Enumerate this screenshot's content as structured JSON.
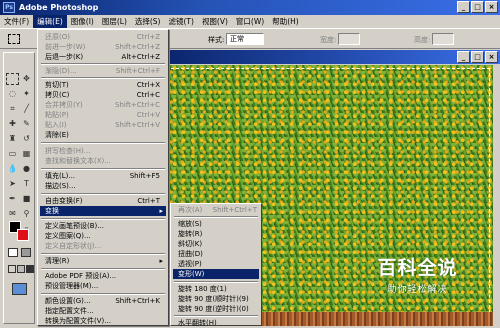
{
  "app": {
    "title": "Adobe Photoshop",
    "icon": "Ps"
  },
  "window_buttons": [
    "_",
    "□",
    "×"
  ],
  "menubar": [
    {
      "label": "文件(F)"
    },
    {
      "label": "编辑(E)"
    },
    {
      "label": "图像(I)"
    },
    {
      "label": "图层(L)"
    },
    {
      "label": "选择(S)"
    },
    {
      "label": "滤镜(T)"
    },
    {
      "label": "视图(V)"
    },
    {
      "label": "窗口(W)"
    },
    {
      "label": "帮助(H)"
    }
  ],
  "options": {
    "style_label": "样式:",
    "style_value": "正常",
    "width_label": "宽度:",
    "height_label": "高度:"
  },
  "edit_menu": [
    {
      "label": "还原(O)",
      "shortcut": "Ctrl+Z",
      "disabled": true
    },
    {
      "label": "前进一步(W)",
      "shortcut": "Shift+Ctrl+Z",
      "disabled": true
    },
    {
      "label": "后退一步(K)",
      "shortcut": "Alt+Ctrl+Z",
      "disabled": false
    },
    {
      "sep": true
    },
    {
      "label": "渐隐(D)...",
      "shortcut": "Shift+Ctrl+F",
      "disabled": true
    },
    {
      "sep": true
    },
    {
      "label": "剪切(T)",
      "shortcut": "Ctrl+X",
      "disabled": false
    },
    {
      "label": "拷贝(C)",
      "shortcut": "Ctrl+C",
      "disabled": false
    },
    {
      "label": "合并拷贝(Y)",
      "shortcut": "Shift+Ctrl+C",
      "disabled": true
    },
    {
      "label": "粘贴(P)",
      "shortcut": "Ctrl+V",
      "disabled": true
    },
    {
      "label": "贴入(I)",
      "shortcut": "Shift+Ctrl+V",
      "disabled": true
    },
    {
      "label": "清除(E)",
      "shortcut": "",
      "disabled": false
    },
    {
      "sep": true
    },
    {
      "label": "拼写检查(H)...",
      "shortcut": "",
      "disabled": true
    },
    {
      "label": "查找和替换文本(X)...",
      "shortcut": "",
      "disabled": true
    },
    {
      "sep": true
    },
    {
      "label": "填充(L)...",
      "shortcut": "Shift+F5",
      "disabled": false
    },
    {
      "label": "描边(S)...",
      "shortcut": "",
      "disabled": false
    },
    {
      "sep": true
    },
    {
      "label": "自由变换(F)",
      "shortcut": "Ctrl+T",
      "disabled": false
    },
    {
      "label": "变换",
      "shortcut": "",
      "disabled": false,
      "highlighted": true,
      "submenu": true
    },
    {
      "sep": true
    },
    {
      "label": "定义画笔预设(B)...",
      "shortcut": "",
      "disabled": false
    },
    {
      "label": "定义图案(Q)...",
      "shortcut": "",
      "disabled": false
    },
    {
      "label": "定义自定形状(J)...",
      "shortcut": "",
      "disabled": true
    },
    {
      "sep": true
    },
    {
      "label": "清理(R)",
      "shortcut": "",
      "disabled": false,
      "submenu": true
    },
    {
      "sep": true
    },
    {
      "label": "Adobe PDF 预设(A)...",
      "shortcut": "",
      "disabled": false
    },
    {
      "label": "预设管理器(M)...",
      "shortcut": "",
      "disabled": false
    },
    {
      "sep": true
    },
    {
      "label": "颜色设置(G)...",
      "shortcut": "Shift+Ctrl+K",
      "disabled": false
    },
    {
      "label": "指定配置文件...",
      "shortcut": "",
      "disabled": false
    },
    {
      "label": "转换为配置文件(V)...",
      "shortcut": "",
      "disabled": false
    }
  ],
  "transform_menu": [
    {
      "label": "再次(A)",
      "shortcut": "Shift+Ctrl+T",
      "disabled": true
    },
    {
      "sep": true
    },
    {
      "label": "缩放(S)"
    },
    {
      "label": "旋转(R)"
    },
    {
      "label": "斜切(K)"
    },
    {
      "label": "扭曲(D)"
    },
    {
      "label": "透视(P)"
    },
    {
      "label": "变形(W)",
      "highlighted": true
    },
    {
      "sep": true
    },
    {
      "label": "旋转 180 度(1)"
    },
    {
      "label": "旋转 90 度(顺时针)(9)"
    },
    {
      "label": "旋转 90 度(逆时针)(0)"
    },
    {
      "sep": true
    },
    {
      "label": "水平翻转(H)"
    }
  ],
  "watermark": {
    "big": "百科全说",
    "small": "助你轻松解决"
  }
}
